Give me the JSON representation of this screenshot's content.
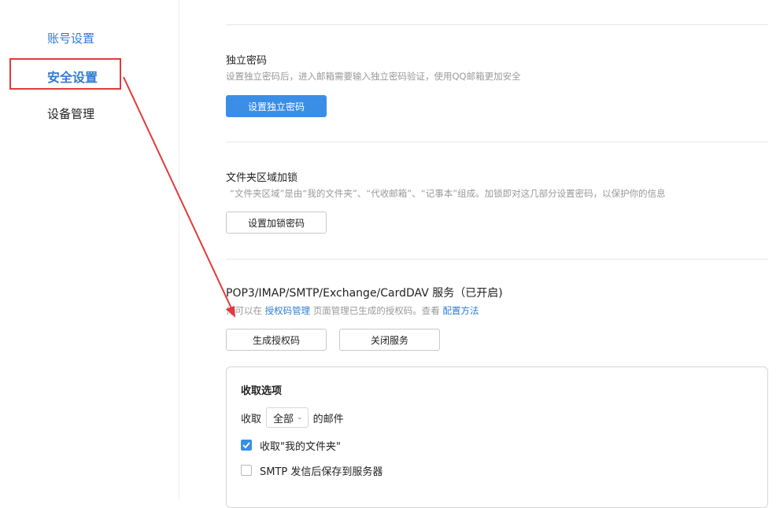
{
  "sidebar": {
    "items": [
      {
        "label": "账号设置"
      },
      {
        "label": "安全设置"
      },
      {
        "label": "设备管理"
      }
    ]
  },
  "independent_password": {
    "title": "独立密码",
    "desc": "设置独立密码后，进入邮箱需要输入独立密码验证，使用QQ邮箱更加安全",
    "button": "设置独立密码"
  },
  "folder_lock": {
    "title": "文件夹区域加锁",
    "desc": "“文件夹区域”是由“我的文件夹”、“代收邮箱”、“记事本”组成。加锁即对这几部分设置密码，以保护你的信息",
    "button": "设置加锁密码"
  },
  "pop3": {
    "title": "POP3/IMAP/SMTP/Exchange/CardDAV 服务（已开启)",
    "desc_prefix": "你可以在",
    "auth_link": "授权码管理",
    "desc_middle": "页面管理已生成的授权码。查看",
    "config_link": "配置方法",
    "generate_button": "生成授权码",
    "close_button": "关闭服务"
  },
  "receive_options": {
    "title": "收取选项",
    "receive_label": "收取",
    "receive_select": "全部",
    "receive_suffix": "的邮件",
    "option_my_folder": "收取\"我的文件夹\"",
    "option_smtp_save": "SMTP 发信后保存到服务器",
    "option_my_folder_checked": true,
    "option_smtp_save_checked": false
  },
  "colors": {
    "accent": "#3a8ee6",
    "link": "#2f7bd6",
    "annotation_red": "#e23a3a"
  }
}
